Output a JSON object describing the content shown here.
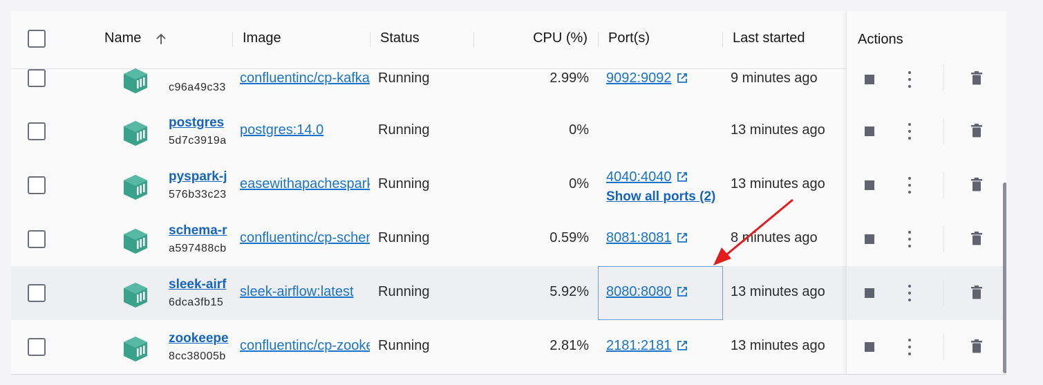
{
  "header": {
    "name": "Name",
    "image": "Image",
    "status": "Status",
    "cpu": "CPU (%)",
    "ports": "Port(s)",
    "last_started": "Last started",
    "actions": "Actions",
    "sort_icon": "arrow-up-icon"
  },
  "colors": {
    "accent": "#1a73c9",
    "cube": "#3aa18b",
    "arrow": "#e21b1b"
  },
  "rows": [
    {
      "name": "",
      "id": "c96a49c33",
      "image": "confluentinc/cp-kafka",
      "status": "Running",
      "cpu": "2.99%",
      "port": "9092:9092",
      "show_all": "",
      "last_started": "9 minutes ago"
    },
    {
      "name": "postgres",
      "id": "5d7c3919a",
      "image": "postgres:14.0",
      "status": "Running",
      "cpu": "0%",
      "port": "",
      "show_all": "",
      "last_started": "13 minutes ago"
    },
    {
      "name": "pyspark-j",
      "id": "576b33c23",
      "image": "easewithapachespark",
      "status": "Running",
      "cpu": "0%",
      "port": "4040:4040",
      "show_all": "Show all ports (2)",
      "last_started": "13 minutes ago"
    },
    {
      "name": "schema-r",
      "id": "a597488cb",
      "image": "confluentinc/cp-schema-registry",
      "status": "Running",
      "cpu": "0.59%",
      "port": "8081:8081",
      "show_all": "",
      "last_started": "8 minutes ago"
    },
    {
      "name": "sleek-airf",
      "id": "6dca3fb15",
      "image": "sleek-airflow:latest",
      "status": "Running",
      "cpu": "5.92%",
      "port": "8080:8080",
      "show_all": "",
      "last_started": "13 minutes ago"
    },
    {
      "name": "zookeepe",
      "id": "8cc38005b",
      "image": "confluentinc/cp-zookeeper",
      "status": "Running",
      "cpu": "2.81%",
      "port": "2181:2181",
      "show_all": "",
      "last_started": "13 minutes ago"
    }
  ]
}
